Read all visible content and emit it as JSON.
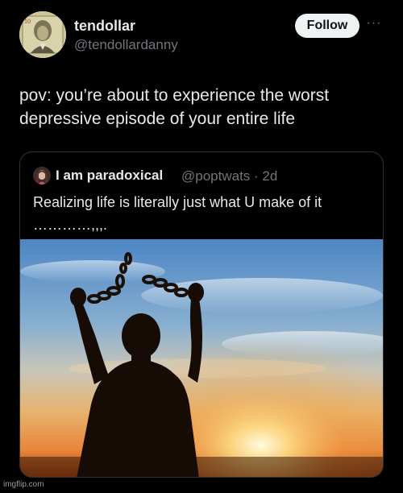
{
  "tweet": {
    "display_name": "tendollar",
    "handle": "@tendollardanny",
    "follow_label": "Follow",
    "more_label": "···",
    "text": "pov: you’re about to experience the worst depressive episode of your entire life"
  },
  "quote": {
    "display_name": "I am paradoxical",
    "handle_time": "@poptwats · 2d",
    "text": "Realizing life is literally just what U make of it\n…………,,,.",
    "image_icon": "silhouette-breaking-chains-sunset"
  },
  "watermark": "imgflip.com",
  "colors": {
    "background": "#000000",
    "primary_text": "#e7e9ea",
    "secondary_text": "#71767b",
    "follow_button_bg": "#eff3f4",
    "border": "#2f3336"
  }
}
